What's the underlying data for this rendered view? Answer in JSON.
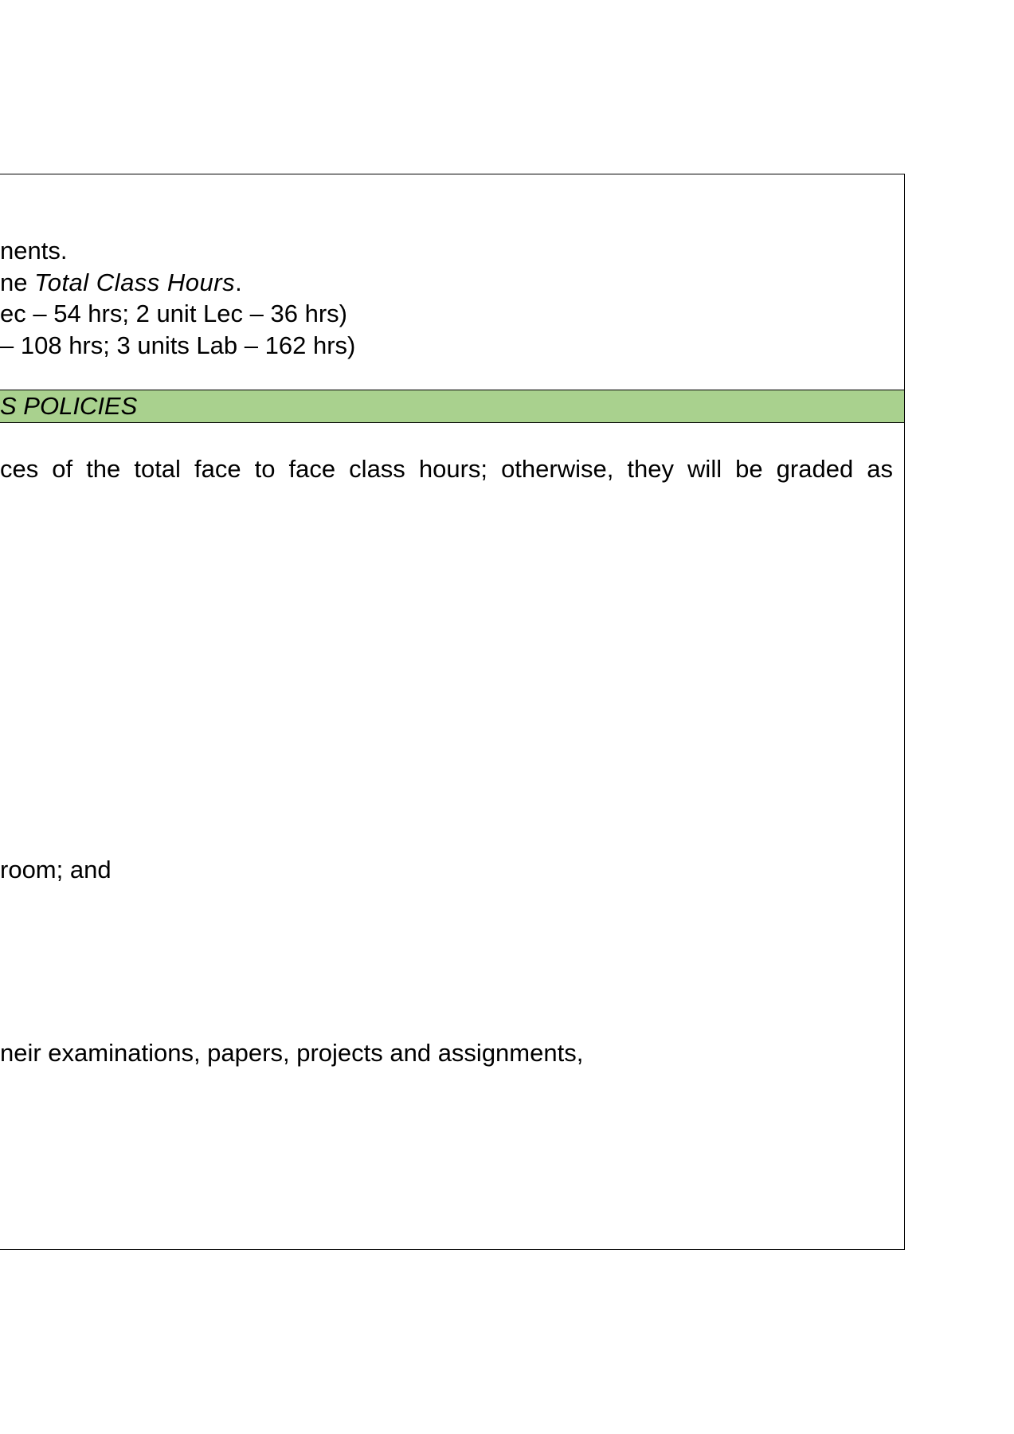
{
  "colors": {
    "section_header_bg": "#a9d18e",
    "border": "#000000",
    "text": "#000000"
  },
  "hours_block": {
    "line1": "nents.",
    "line2_prefix": "ne ",
    "line2_emph": "Total Class Hours",
    "line2_suffix": ".",
    "line3": "ec – 54 hrs; 2 unit Lec – 36 hrs)",
    "line4": "– 108 hrs; 3 units Lab – 162 hrs)"
  },
  "section": {
    "title": "S POLICIES"
  },
  "policies": {
    "attendance_line": "ces of the total face to face class hours; otherwise, they will be graded as",
    "conduct_line": "room; and",
    "honesty_line": "neir examinations, papers, projects and assignments,"
  }
}
